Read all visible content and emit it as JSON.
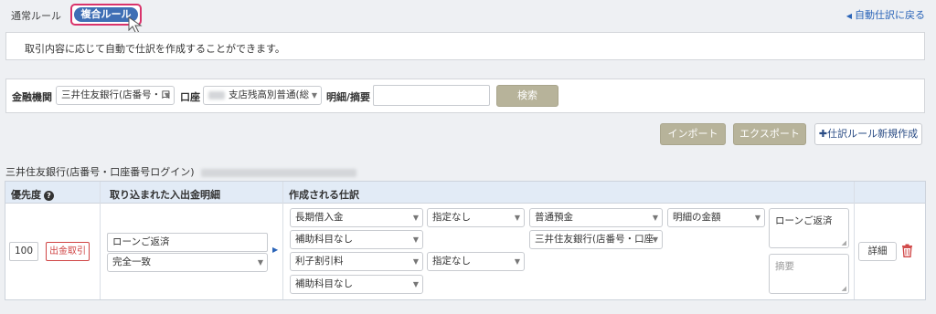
{
  "tabs": {
    "normal_label": "通常ルール",
    "compound_label": "複合ルール"
  },
  "back_link": "自動仕訳に戻る",
  "info": {
    "message": "取引内容に応じて自動で仕訳を作成することができます。"
  },
  "filter": {
    "bank_label": "金融機関",
    "bank_value": "三井住友銀行(店番号・口",
    "account_label": "口座",
    "account_value": "支店残高別普通(総",
    "memo_label": "明細/摘要",
    "memo_value": "",
    "search_button": "検索"
  },
  "actions": {
    "import_button": "インポート",
    "export_button": "エクスポート",
    "new_rule_button": "✚仕訳ルール新規作成"
  },
  "bank_section_title": "三井住友銀行(店番号・口座番号ログイン)",
  "table": {
    "headers": {
      "priority": "優先度",
      "imported": "取り込まれた入出金明細",
      "created": "作成される仕訳"
    },
    "row": {
      "priority": "100",
      "direction_tag": "出金取引",
      "match_text": "ローンご返済",
      "match_mode": "完全一致",
      "debit1_account": "長期借入金",
      "debit1_tax": "指定なし",
      "debit1_sub": "補助科目なし",
      "credit_account": "普通預金",
      "credit_sub": "三井住友銀行(店番号・口座",
      "amount_mode": "明細の金額",
      "debit2_account": "利子割引料",
      "debit2_tax": "指定なし",
      "debit2_sub": "補助科目なし",
      "memo1": "ローンご返済",
      "memo2_placeholder": "摘要",
      "detail_button": "詳細"
    }
  },
  "colors": {
    "tab_active": "#3f6fb5",
    "tab_highlight": "#d9336b",
    "link": "#2a64b8",
    "olive_button": "#b7b39a",
    "header_bg": "#e2ebf6",
    "danger": "#d04545"
  }
}
